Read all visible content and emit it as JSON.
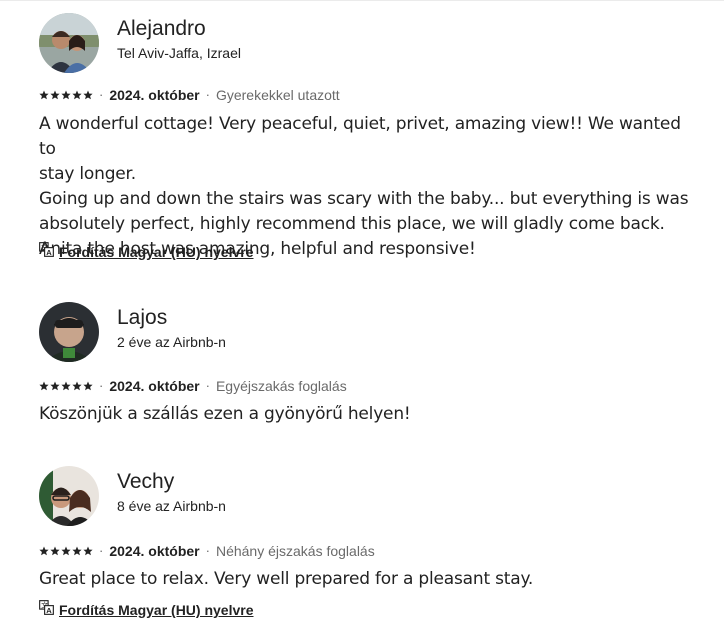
{
  "reviews": [
    {
      "name": "Alejandro",
      "subtitle": "Tel Aviv-Jaffa, Izrael",
      "rating": 5,
      "date": "2024. október",
      "trip": "Gyerekekkel utazott",
      "text_lines": [
        "A wonderful cottage! Very peaceful, quiet, privet, amazing view!! We wanted to",
        "stay longer.",
        "Going up and down the stairs was scary with the baby... but everything is was",
        "absolutely perfect, highly recommend this place, we will gladly come back.",
        "Anita the host was amazing, helpful and responsive!"
      ],
      "translate_label": "Fordítás Magyar (HU) nyelvre"
    },
    {
      "name": "Lajos",
      "subtitle": "2 éve az Airbnb-n",
      "rating": 5,
      "date": "2024. október",
      "trip": "Egyéjszakás foglalás",
      "text_lines": [
        "Köszönjük a szállás ezen a gyönyörű helyen!"
      ]
    },
    {
      "name": "Vechy",
      "subtitle": "8 éve az Airbnb-n",
      "rating": 5,
      "date": "2024. október",
      "trip": "Néhány éjszakás foglalás",
      "text_lines": [
        "Great place to relax. Very well prepared for a pleasant stay."
      ],
      "translate_label": "Fordítás Magyar (HU) nyelvre"
    }
  ],
  "separator": "·",
  "icons": {
    "star": "star-icon",
    "translate": "translate-icon"
  },
  "colors": {
    "text": "#222222",
    "muted": "#6a6a6a",
    "star": "#222222"
  }
}
